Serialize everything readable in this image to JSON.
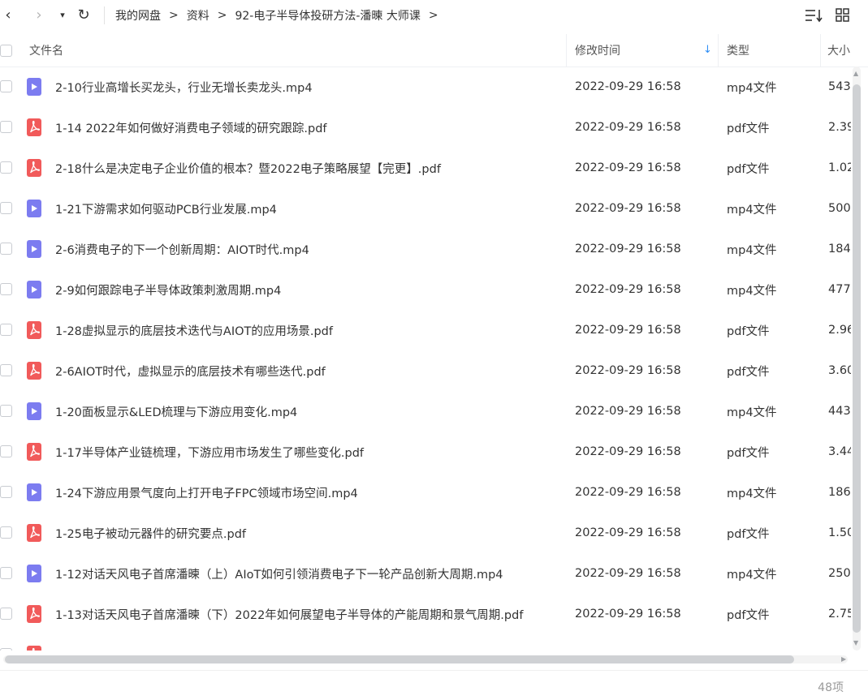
{
  "nav": {
    "back_icon": "‹",
    "forward_icon": "›",
    "dropdown_icon": "▾",
    "refresh_icon": "↻"
  },
  "breadcrumb": {
    "items": [
      "我的网盘",
      "资料",
      "92-电子半导体投研方法-潘暕 大师课"
    ],
    "separator": ">"
  },
  "header": {
    "name": "文件名",
    "modified": "修改时间",
    "type": "类型",
    "size": "大小",
    "sort_icon": "↓"
  },
  "files": [
    {
      "name": "2-10行业高增长买龙头，行业无增长卖龙头.mp4",
      "kind": "mp4",
      "modified": "2022-09-29 16:58",
      "type": "mp4文件",
      "size": "543"
    },
    {
      "name": "1-14 2022年如何做好消费电子领域的研究跟踪.pdf",
      "kind": "pdf",
      "modified": "2022-09-29 16:58",
      "type": "pdf文件",
      "size": "2.39"
    },
    {
      "name": "2-18什么是决定电子企业价值的根本？暨2022电子策略展望【完更】.pdf",
      "kind": "pdf",
      "modified": "2022-09-29 16:58",
      "type": "pdf文件",
      "size": "1.02"
    },
    {
      "name": "1-21下游需求如何驱动PCB行业发展.mp4",
      "kind": "mp4",
      "modified": "2022-09-29 16:58",
      "type": "mp4文件",
      "size": "500"
    },
    {
      "name": "2-6消费电子的下一个创新周期：AIOT时代.mp4",
      "kind": "mp4",
      "modified": "2022-09-29 16:58",
      "type": "mp4文件",
      "size": "184"
    },
    {
      "name": "2-9如何跟踪电子半导体政策刺激周期.mp4",
      "kind": "mp4",
      "modified": "2022-09-29 16:58",
      "type": "mp4文件",
      "size": "477"
    },
    {
      "name": "1-28虚拟显示的底层技术迭代与AIOT的应用场景.pdf",
      "kind": "pdf",
      "modified": "2022-09-29 16:58",
      "type": "pdf文件",
      "size": "2.96"
    },
    {
      "name": "2-6AIOT时代，虚拟显示的底层技术有哪些迭代.pdf",
      "kind": "pdf",
      "modified": "2022-09-29 16:58",
      "type": "pdf文件",
      "size": "3.60"
    },
    {
      "name": "1-20面板显示&LED梳理与下游应用变化.mp4",
      "kind": "mp4",
      "modified": "2022-09-29 16:58",
      "type": "mp4文件",
      "size": "443"
    },
    {
      "name": "1-17半导体产业链梳理，下游应用市场发生了哪些变化.pdf",
      "kind": "pdf",
      "modified": "2022-09-29 16:58",
      "type": "pdf文件",
      "size": "3.44"
    },
    {
      "name": "1-24下游应用景气度向上打开电子FPC领域市场空间.mp4",
      "kind": "mp4",
      "modified": "2022-09-29 16:58",
      "type": "mp4文件",
      "size": "186"
    },
    {
      "name": "1-25电子被动元器件的研究要点.pdf",
      "kind": "pdf",
      "modified": "2022-09-29 16:58",
      "type": "pdf文件",
      "size": "1.50"
    },
    {
      "name": "1-12对话天风电子首席潘暕（上）AIoT如何引领消费电子下一轮产品创新大周期.mp4",
      "kind": "mp4",
      "modified": "2022-09-29 16:58",
      "type": "mp4文件",
      "size": "250"
    },
    {
      "name": "1-13对话天风电子首席潘暕（下）2022年如何展望电子半导体的产能周期和景气周期.pdf",
      "kind": "pdf",
      "modified": "2022-09-29 16:58",
      "type": "pdf文件",
      "size": "2.75"
    }
  ],
  "partial_row": {
    "kind": "pdf"
  },
  "footer": {
    "count": "48项"
  },
  "colors": {
    "mp4_icon": "#7c7cf0",
    "pdf_icon": "#f15a5a",
    "sort_accent": "#2f8ef5"
  }
}
